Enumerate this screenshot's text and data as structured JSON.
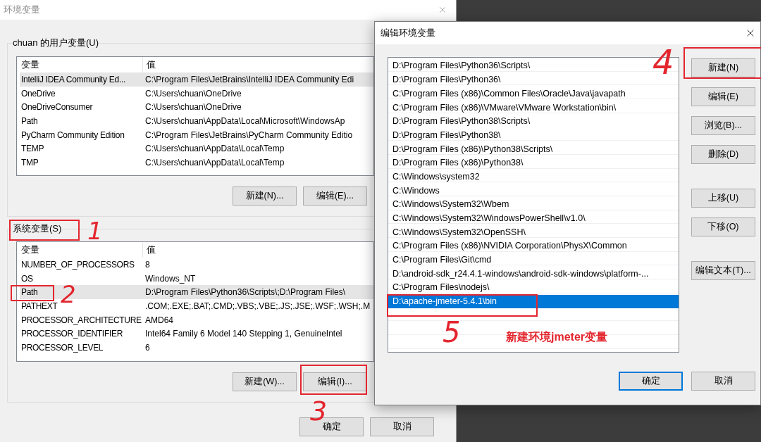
{
  "env_window": {
    "title": "环境变量",
    "user_vars": {
      "title": "chuan 的用户变量(U)",
      "columns": [
        "变量",
        "值"
      ],
      "rows": [
        {
          "name": "IntelliJ IDEA Community Ed...",
          "value": "C:\\Program Files\\JetBrains\\IntelliJ IDEA Community Edi",
          "selected": true
        },
        {
          "name": "OneDrive",
          "value": "C:\\Users\\chuan\\OneDrive",
          "selected": false
        },
        {
          "name": "OneDriveConsumer",
          "value": "C:\\Users\\chuan\\OneDrive",
          "selected": false
        },
        {
          "name": "Path",
          "value": "C:\\Users\\chuan\\AppData\\Local\\Microsoft\\WindowsAp",
          "selected": false
        },
        {
          "name": "PyCharm Community Edition",
          "value": "C:\\Program Files\\JetBrains\\PyCharm Community Editio",
          "selected": false
        },
        {
          "name": "TEMP",
          "value": "C:\\Users\\chuan\\AppData\\Local\\Temp",
          "selected": false
        },
        {
          "name": "TMP",
          "value": "C:\\Users\\chuan\\AppData\\Local\\Temp",
          "selected": false
        }
      ],
      "buttons": [
        "新建(N)...",
        "编辑(E)..."
      ]
    },
    "system_vars": {
      "title": "系统变量(S)",
      "columns": [
        "变量",
        "值"
      ],
      "rows": [
        {
          "name": "NUMBER_OF_PROCESSORS",
          "value": "8",
          "selected": false
        },
        {
          "name": "OS",
          "value": "Windows_NT",
          "selected": false
        },
        {
          "name": "Path",
          "value": "D:\\Program Files\\Python36\\Scripts\\;D:\\Program Files\\",
          "selected": true
        },
        {
          "name": "PATHEXT",
          "value": ".COM;.EXE;.BAT;.CMD;.VBS;.VBE;.JS;.JSE;.WSF;.WSH;.M",
          "selected": false
        },
        {
          "name": "PROCESSOR_ARCHITECTURE",
          "value": "AMD64",
          "selected": false
        },
        {
          "name": "PROCESSOR_IDENTIFIER",
          "value": "Intel64 Family 6 Model 140 Stepping 1, GenuineIntel",
          "selected": false
        },
        {
          "name": "PROCESSOR_LEVEL",
          "value": "6",
          "selected": false
        }
      ],
      "buttons": [
        "新建(W)...",
        "编辑(I)..."
      ]
    },
    "buttons": [
      "确定",
      "取消"
    ]
  },
  "edit_window": {
    "title": "编辑环境变量",
    "entries": [
      {
        "text": "D:\\Program Files\\Python36\\Scripts\\",
        "selected": false
      },
      {
        "text": "D:\\Program Files\\Python36\\",
        "selected": false
      },
      {
        "text": "C:\\Program Files (x86)\\Common Files\\Oracle\\Java\\javapath",
        "selected": false
      },
      {
        "text": "C:\\Program Files (x86)\\VMware\\VMware Workstation\\bin\\",
        "selected": false
      },
      {
        "text": "D:\\Program Files\\Python38\\Scripts\\",
        "selected": false
      },
      {
        "text": "D:\\Program Files\\Python38\\",
        "selected": false
      },
      {
        "text": "D:\\Program Files (x86)\\Python38\\Scripts\\",
        "selected": false
      },
      {
        "text": "D:\\Program Files (x86)\\Python38\\",
        "selected": false
      },
      {
        "text": "C:\\Windows\\system32",
        "selected": false
      },
      {
        "text": "C:\\Windows",
        "selected": false
      },
      {
        "text": "C:\\Windows\\System32\\Wbem",
        "selected": false
      },
      {
        "text": "C:\\Windows\\System32\\WindowsPowerShell\\v1.0\\",
        "selected": false
      },
      {
        "text": "C:\\Windows\\System32\\OpenSSH\\",
        "selected": false
      },
      {
        "text": "C:\\Program Files (x86)\\NVIDIA Corporation\\PhysX\\Common",
        "selected": false
      },
      {
        "text": "C:\\Program Files\\Git\\cmd",
        "selected": false
      },
      {
        "text": "D:\\android-sdk_r24.4.1-windows\\android-sdk-windows\\platform-...",
        "selected": false
      },
      {
        "text": "C:\\Program Files\\nodejs\\",
        "selected": false
      },
      {
        "text": "D:\\apache-jmeter-5.4.1\\bin",
        "selected": true
      }
    ],
    "side_buttons": [
      [
        "新建(N)",
        "编辑(E)",
        "浏览(B)...",
        "删除(D)"
      ],
      [
        "上移(U)",
        "下移(O)"
      ],
      [
        "编辑文本(T)..."
      ]
    ],
    "buttons": [
      {
        "label": "确定",
        "focused": true
      },
      {
        "label": "取消",
        "focused": false
      }
    ]
  },
  "annotations": {
    "marks": [
      {
        "label": "1"
      },
      {
        "label": "2"
      },
      {
        "label": "3"
      },
      {
        "label": "4"
      },
      {
        "label": "5"
      }
    ],
    "note": "新建环境jmeter变量"
  }
}
